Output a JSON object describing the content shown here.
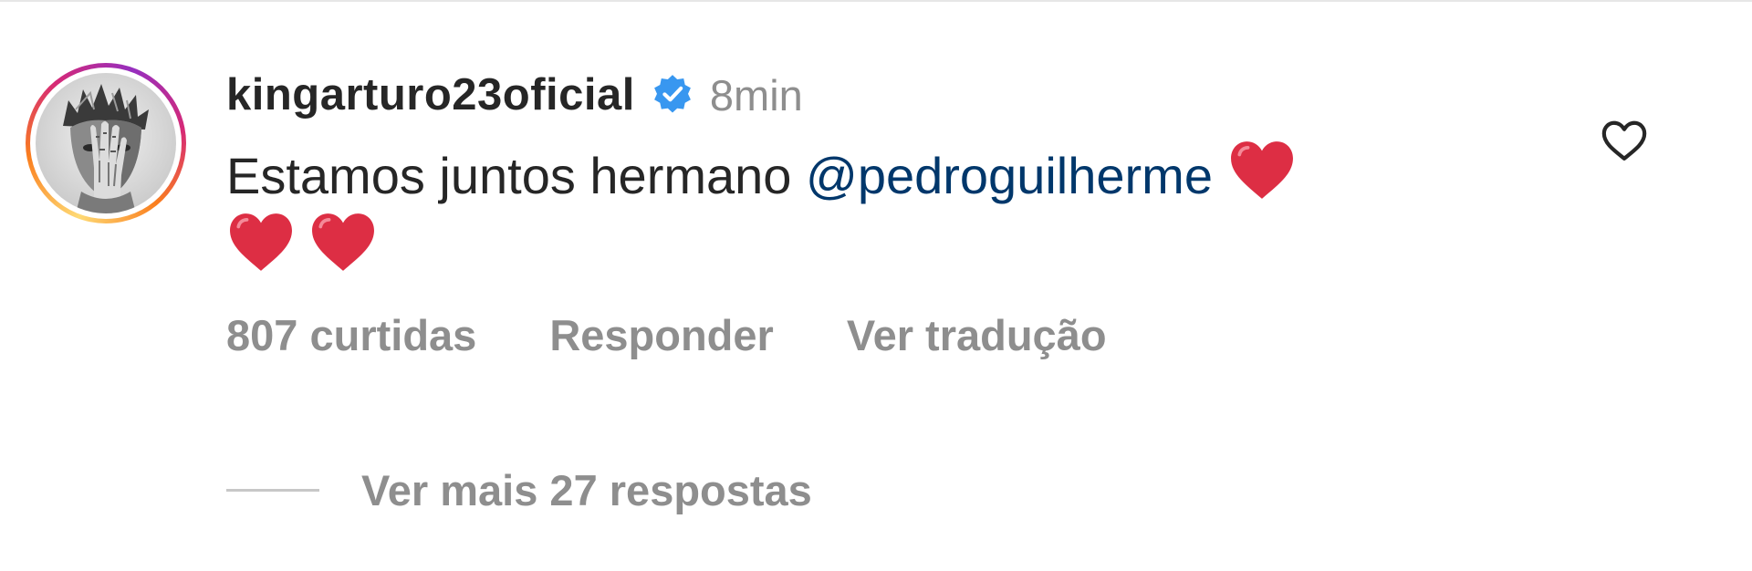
{
  "comment": {
    "username": "kingarturo23oficial",
    "verified": true,
    "time": "8min",
    "text_before_mention": "Estamos juntos hermano ",
    "mention": "@pedroguilherme",
    "emoji": [
      "❤️",
      "❤️",
      "❤️"
    ],
    "liked": false,
    "actions": {
      "likes": "807 curtidas",
      "reply": "Responder",
      "translate": "Ver tradução"
    },
    "view_more_replies": "Ver mais 27 respostas"
  },
  "colors": {
    "username": "#262626",
    "secondary_text": "#8e8e8e",
    "mention": "#00376b",
    "verified_badge": "#3897f0",
    "heart_emoji": "#dd2e44"
  },
  "icons": {
    "avatar": "profile-photo",
    "verified": "verified-badge-icon",
    "like": "heart-outline-icon",
    "emoji": "red-heart-emoji"
  }
}
